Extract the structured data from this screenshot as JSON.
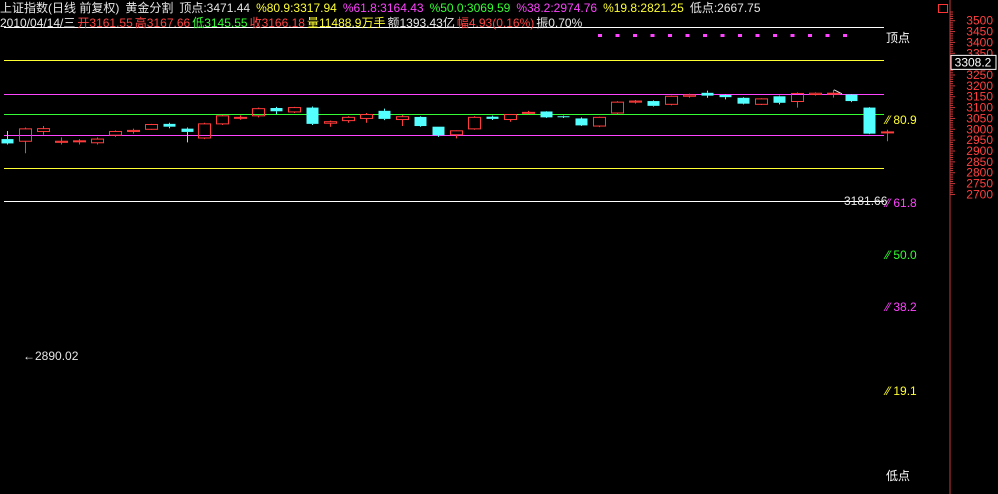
{
  "header": {
    "index_name": "上证指数(日线 前复权)",
    "study_name": "黄金分割",
    "top_label": "顶点:3471.44",
    "fib_80_9": "%80.9:3317.94",
    "fib_61_8": "%61.8:3164.43",
    "fib_50_0": "%50.0:3069.59",
    "fib_38_2": "%38.2:2974.76",
    "fib_19_8": "%19.8:2821.25",
    "bottom_label": "低点:2667.75"
  },
  "quote": {
    "date": "2010/04/14/三",
    "open": "开3161.55",
    "high": "高3167.66",
    "low": "低3145.55",
    "close": "收3166.18",
    "volume": "量11488.9万手",
    "amount": "额1393.43亿",
    "change": "幅4.93(0.16%)",
    "amplitude": "振0.70%"
  },
  "levels": {
    "top": "顶点",
    "l80": "80.9",
    "l61": "61.8",
    "l50": "50.0",
    "l38": "38.2",
    "l19": "19.1",
    "bottom": "低点"
  },
  "annotations": {
    "low_marker": "←2890.02",
    "high_marker": "3181.66",
    "crosshair_value": "3308.2"
  },
  "colors": {
    "up": "#ff3b3b",
    "down": "#54ffff",
    "top_line": "#ffffff",
    "l80": "#ffff33",
    "l61": "#ff44ff",
    "l50": "#33ff33",
    "l38": "#ff44ff",
    "l19": "#ffff33",
    "bottom_line": "#ffffff",
    "axis": "#c8373a"
  },
  "chart_data": {
    "type": "candlestick",
    "yticks": [
      2700,
      2750,
      2800,
      2850,
      2900,
      2950,
      3000,
      3050,
      3100,
      3150,
      3200,
      3250,
      3300,
      3350,
      3400,
      3450,
      3500
    ],
    "ylim": [
      2675,
      3510
    ],
    "fib_levels": [
      {
        "name": "顶点",
        "value": 3471.44
      },
      {
        "name": "80.9",
        "value": 3317.94
      },
      {
        "name": "61.8",
        "value": 3164.43
      },
      {
        "name": "50.0",
        "value": 3069.59
      },
      {
        "name": "38.2",
        "value": 2974.76
      },
      {
        "name": "19.1",
        "value": 2821.25
      },
      {
        "name": "低点",
        "value": 2667.75
      }
    ],
    "candles": [
      {
        "o": 2955,
        "h": 2992,
        "l": 2930,
        "c": 2935
      },
      {
        "o": 2945,
        "h": 3008,
        "l": 2890,
        "c": 3002
      },
      {
        "o": 2990,
        "h": 3015,
        "l": 2975,
        "c": 3003
      },
      {
        "o": 2940,
        "h": 2963,
        "l": 2930,
        "c": 2945
      },
      {
        "o": 2945,
        "h": 2955,
        "l": 2930,
        "c": 2947
      },
      {
        "o": 2938,
        "h": 2963,
        "l": 2930,
        "c": 2955
      },
      {
        "o": 2973,
        "h": 2995,
        "l": 2965,
        "c": 2990
      },
      {
        "o": 2990,
        "h": 3003,
        "l": 2980,
        "c": 2995
      },
      {
        "o": 3000,
        "h": 3025,
        "l": 2998,
        "c": 3022
      },
      {
        "o": 3025,
        "h": 3030,
        "l": 3005,
        "c": 3012
      },
      {
        "o": 3003,
        "h": 3008,
        "l": 2940,
        "c": 2988
      },
      {
        "o": 2960,
        "h": 3030,
        "l": 2955,
        "c": 3025
      },
      {
        "o": 3025,
        "h": 3065,
        "l": 3020,
        "c": 3062
      },
      {
        "o": 3052,
        "h": 3064,
        "l": 3044,
        "c": 3055
      },
      {
        "o": 3062,
        "h": 3100,
        "l": 3055,
        "c": 3095
      },
      {
        "o": 3098,
        "h": 3103,
        "l": 3070,
        "c": 3083
      },
      {
        "o": 3080,
        "h": 3103,
        "l": 3075,
        "c": 3100
      },
      {
        "o": 3100,
        "h": 3105,
        "l": 3020,
        "c": 3025
      },
      {
        "o": 3028,
        "h": 3040,
        "l": 3012,
        "c": 3035
      },
      {
        "o": 3040,
        "h": 3060,
        "l": 3030,
        "c": 3055
      },
      {
        "o": 3050,
        "h": 3075,
        "l": 3030,
        "c": 3068
      },
      {
        "o": 3085,
        "h": 3095,
        "l": 3042,
        "c": 3048
      },
      {
        "o": 3045,
        "h": 3065,
        "l": 3015,
        "c": 3058
      },
      {
        "o": 3057,
        "h": 3060,
        "l": 3012,
        "c": 3015
      },
      {
        "o": 3012,
        "h": 3012,
        "l": 2965,
        "c": 2973
      },
      {
        "o": 2975,
        "h": 2995,
        "l": 2958,
        "c": 2993
      },
      {
        "o": 3002,
        "h": 3060,
        "l": 2998,
        "c": 3055
      },
      {
        "o": 3058,
        "h": 3063,
        "l": 3043,
        "c": 3048
      },
      {
        "o": 3045,
        "h": 3070,
        "l": 3035,
        "c": 3068
      },
      {
        "o": 3075,
        "h": 3085,
        "l": 3070,
        "c": 3078
      },
      {
        "o": 3082,
        "h": 3083,
        "l": 3052,
        "c": 3055
      },
      {
        "o": 3060,
        "h": 3063,
        "l": 3052,
        "c": 3057
      },
      {
        "o": 3050,
        "h": 3055,
        "l": 3015,
        "c": 3018
      },
      {
        "o": 3015,
        "h": 3058,
        "l": 3010,
        "c": 3055
      },
      {
        "o": 3075,
        "h": 3130,
        "l": 3070,
        "c": 3125
      },
      {
        "o": 3125,
        "h": 3135,
        "l": 3118,
        "c": 3130
      },
      {
        "o": 3130,
        "h": 3133,
        "l": 3105,
        "c": 3108
      },
      {
        "o": 3115,
        "h": 3155,
        "l": 3110,
        "c": 3152
      },
      {
        "o": 3152,
        "h": 3164,
        "l": 3145,
        "c": 3158
      },
      {
        "o": 3168,
        "h": 3178,
        "l": 3145,
        "c": 3155
      },
      {
        "o": 3158,
        "h": 3162,
        "l": 3138,
        "c": 3148
      },
      {
        "o": 3145,
        "h": 3148,
        "l": 3115,
        "c": 3118
      },
      {
        "o": 3115,
        "h": 3143,
        "l": 3112,
        "c": 3140
      },
      {
        "o": 3152,
        "h": 3155,
        "l": 3115,
        "c": 3122
      },
      {
        "o": 3128,
        "h": 3170,
        "l": 3100,
        "c": 3165
      },
      {
        "o": 3160,
        "h": 3170,
        "l": 3155,
        "c": 3166
      },
      {
        "o": 3161.55,
        "h": 3181.66,
        "l": 3145.55,
        "c": 3166.18
      },
      {
        "o": 3160,
        "h": 3162,
        "l": 3125,
        "c": 3130
      },
      {
        "o": 3100,
        "h": 3102,
        "l": 2978,
        "c": 2980
      },
      {
        "o": 2985,
        "h": 2998,
        "l": 2945,
        "c": 2988
      }
    ]
  }
}
